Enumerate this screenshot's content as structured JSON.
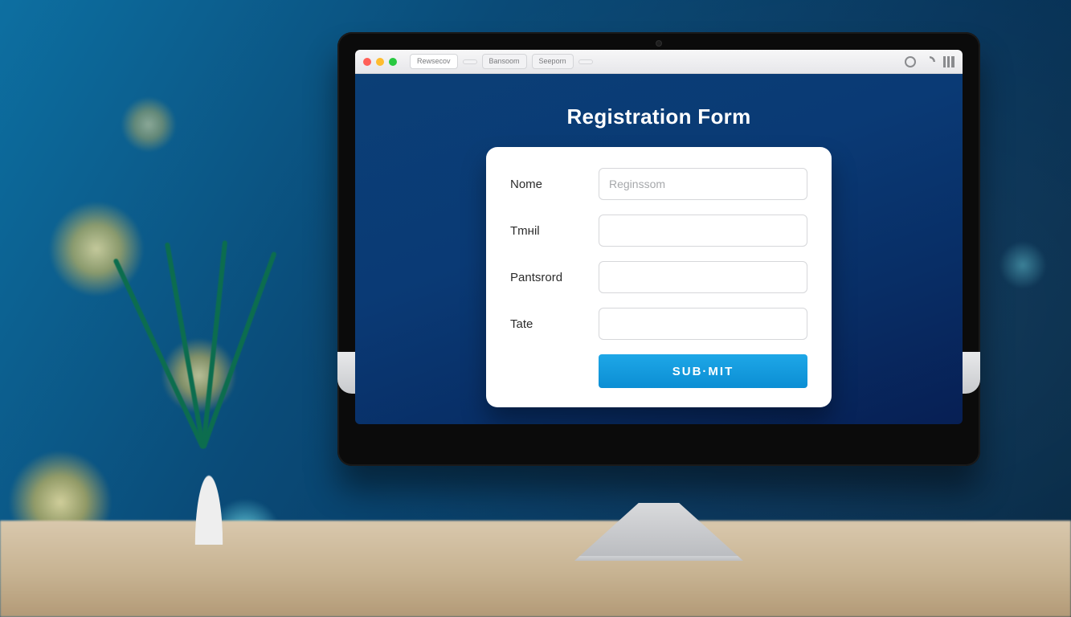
{
  "browser": {
    "tabs": [
      {
        "label": "Rewsecov",
        "active": true
      },
      {
        "label": ""
      },
      {
        "label": "Bansoom"
      },
      {
        "label": "Seeporn"
      },
      {
        "label": ""
      }
    ]
  },
  "page": {
    "title": "Registration Form"
  },
  "form": {
    "fields": [
      {
        "label": "Nome",
        "placeholder": "Reginssom",
        "value": ""
      },
      {
        "label": "Tmнil",
        "placeholder": "",
        "value": ""
      },
      {
        "label": "Pantsrord",
        "placeholder": "",
        "value": ""
      },
      {
        "label": "Tate",
        "placeholder": "",
        "value": ""
      }
    ],
    "submit_label": "SUB·MIT"
  },
  "colors": {
    "page_bg_top": "#0b3f76",
    "page_bg_bot": "#071f54",
    "accent_button": "#1ea7e7"
  }
}
